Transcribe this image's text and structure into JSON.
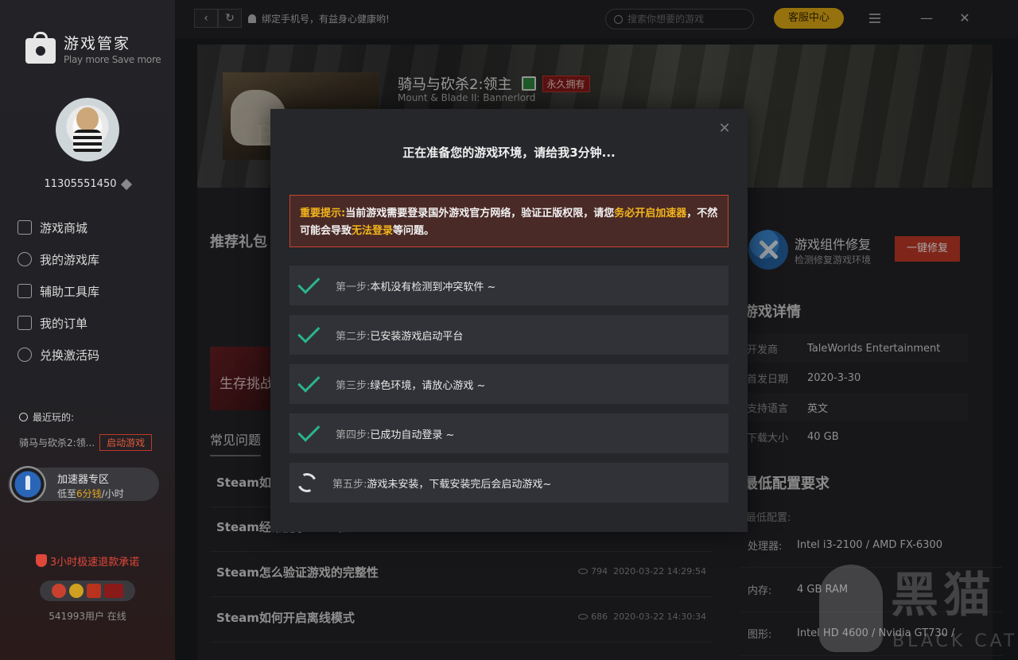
{
  "sidebar": {
    "brand_title": "游戏管家",
    "brand_sub": "Play more Save more",
    "user_id": "11305551450",
    "nav": [
      {
        "label": "游戏商城",
        "icon": "store-icon"
      },
      {
        "label": "我的游戏库",
        "icon": "gamepad-icon"
      },
      {
        "label": "辅助工具库",
        "icon": "toolbox-icon"
      },
      {
        "label": "我的订单",
        "icon": "order-icon"
      },
      {
        "label": "兑换激活码",
        "icon": "redeem-icon"
      }
    ],
    "recent_heading": "最近玩的:",
    "recent_game": "骑马与砍杀2:领...",
    "launch_label": "启动游戏",
    "accel_title": "加速器专区",
    "accel_price_prefix": "低至",
    "accel_price_value": "6分钱",
    "accel_price_suffix": "/小时",
    "refund_text": "3小时极速退款承诺",
    "online_text": "541993用户 在线"
  },
  "topbar": {
    "notice": "绑定手机号，有益身心健康哟!",
    "search_placeholder": "搜索你想要的游戏",
    "service_label": "客服中心"
  },
  "game": {
    "title": "骑马与砍杀2:领主",
    "owned_badge": "永久拥有",
    "subtitle": "Mount & Blade II: Bannerlord",
    "cover_letter": "B"
  },
  "main": {
    "gift_heading": "推荐礼包",
    "gift_label": "生存挑战",
    "faq_heading": "常见问题",
    "faq": [
      {
        "q": "Steam如何",
        "views": "",
        "date": ""
      },
      {
        "q": "Steam经常提示-118和-105",
        "views": "",
        "date": ""
      },
      {
        "q": "Steam怎么验证游戏的完整性",
        "views": "794",
        "date": "2020-03-22 14:29:54"
      },
      {
        "q": "Steam如何开启离线模式",
        "views": "686",
        "date": "2020-03-22 14:30:34"
      }
    ]
  },
  "right": {
    "repair_title": "游戏组件修复",
    "repair_sub": "检测修复游戏环境",
    "repair_btn": "一键修复",
    "detail_heading": "游戏详情",
    "details": [
      {
        "k": "开发商",
        "v": "TaleWorlds Entertainment"
      },
      {
        "k": "首发日期",
        "v": "2020-3-30"
      },
      {
        "k": "支持语言",
        "v": "英文"
      },
      {
        "k": "下载大小",
        "v": "40 GB"
      }
    ],
    "req_heading": "最低配置要求",
    "req_sub": "最低配置:",
    "reqs": [
      {
        "k": "处理器:",
        "v": "Intel i3-2100 / AMD FX-6300"
      },
      {
        "k": "内存:",
        "v": "4 GB RAM"
      },
      {
        "k": "图形:",
        "v": "Intel HD 4600 / Nvidia GT730 /"
      }
    ]
  },
  "modal": {
    "title": "正在准备您的游戏环境，请给我3分钟...",
    "warn_prefix": "重要提示:",
    "warn_text_1": "当前游戏需要登录国外游戏官方网络，验证正版权限，请您",
    "warn_hl_1": "务必开启加速器",
    "warn_text_2": "，不然可能会导致",
    "warn_hl_2": "无法登录",
    "warn_text_3": "等问题。",
    "steps": [
      {
        "label": "第一步:",
        "text": "本机没有检测到冲突软件 ~",
        "state": "done"
      },
      {
        "label": "第二步:",
        "text": "已安装游戏启动平台",
        "state": "done"
      },
      {
        "label": "第三步:",
        "text": "绿色环境，请放心游戏 ~",
        "state": "done"
      },
      {
        "label": "第四步:",
        "text": "已成功自动登录 ~",
        "state": "done"
      },
      {
        "label": "第五步:",
        "text": "游戏未安装，下载安装完后会启动游戏~",
        "state": "loading"
      }
    ]
  },
  "watermark": {
    "cn": "黑猫",
    "en": "BLACK CAT"
  },
  "colors": {
    "accent_green": "#2bb58a",
    "accent_red": "#c53a27",
    "accent_yellow": "#e6b016"
  }
}
